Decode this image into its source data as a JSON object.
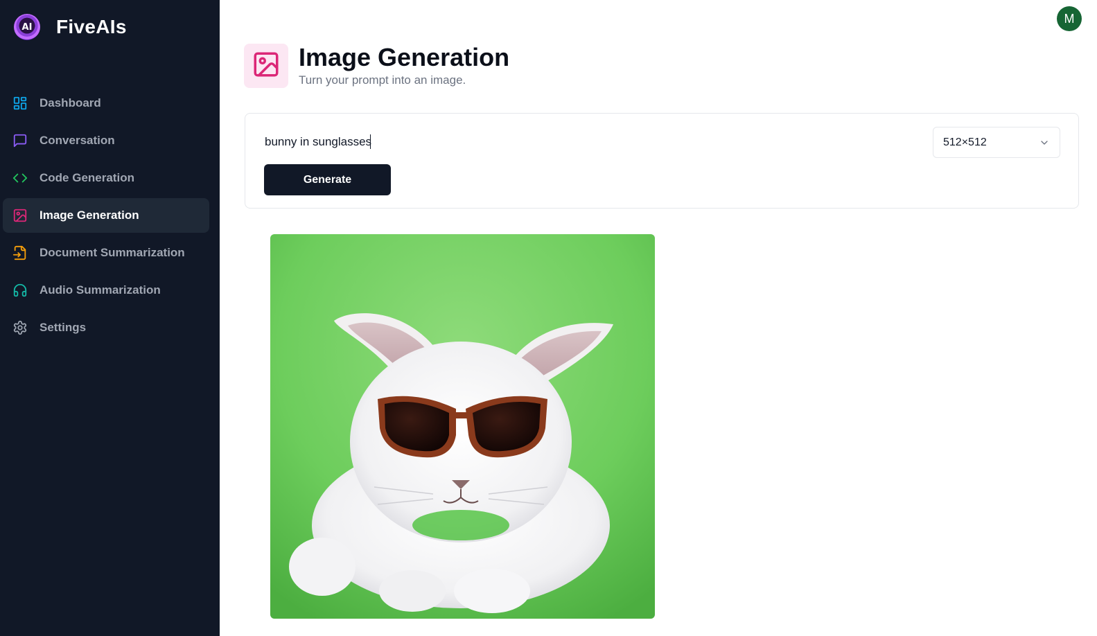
{
  "brand": {
    "name": "FiveAIs",
    "logo_text": "AI"
  },
  "sidebar": {
    "items": [
      {
        "label": "Dashboard",
        "icon": "dashboard-icon",
        "color": "#0ea5e9"
      },
      {
        "label": "Conversation",
        "icon": "message-square-icon",
        "color": "#8b5cf6"
      },
      {
        "label": "Code Generation",
        "icon": "code-icon",
        "color": "#22c55e"
      },
      {
        "label": "Image Generation",
        "icon": "image-icon",
        "color": "#db2777",
        "active": true
      },
      {
        "label": "Document Summarization",
        "icon": "file-input-icon",
        "color": "#f59e0b"
      },
      {
        "label": "Audio Summarization",
        "icon": "headphones-icon",
        "color": "#14b8a6"
      },
      {
        "label": "Settings",
        "icon": "gear-icon",
        "color": "#9ca3af"
      }
    ]
  },
  "user": {
    "avatar_initial": "M"
  },
  "header": {
    "title": "Image Generation",
    "subtitle": "Turn your prompt into an image.",
    "icon": "image-icon",
    "icon_color": "#db2777",
    "icon_bg": "#fce7f3"
  },
  "form": {
    "prompt_value": "bunny in sunglasses",
    "size_selected": "512×512",
    "generate_label": "Generate"
  },
  "result": {
    "image": "generated-bunny-image"
  }
}
